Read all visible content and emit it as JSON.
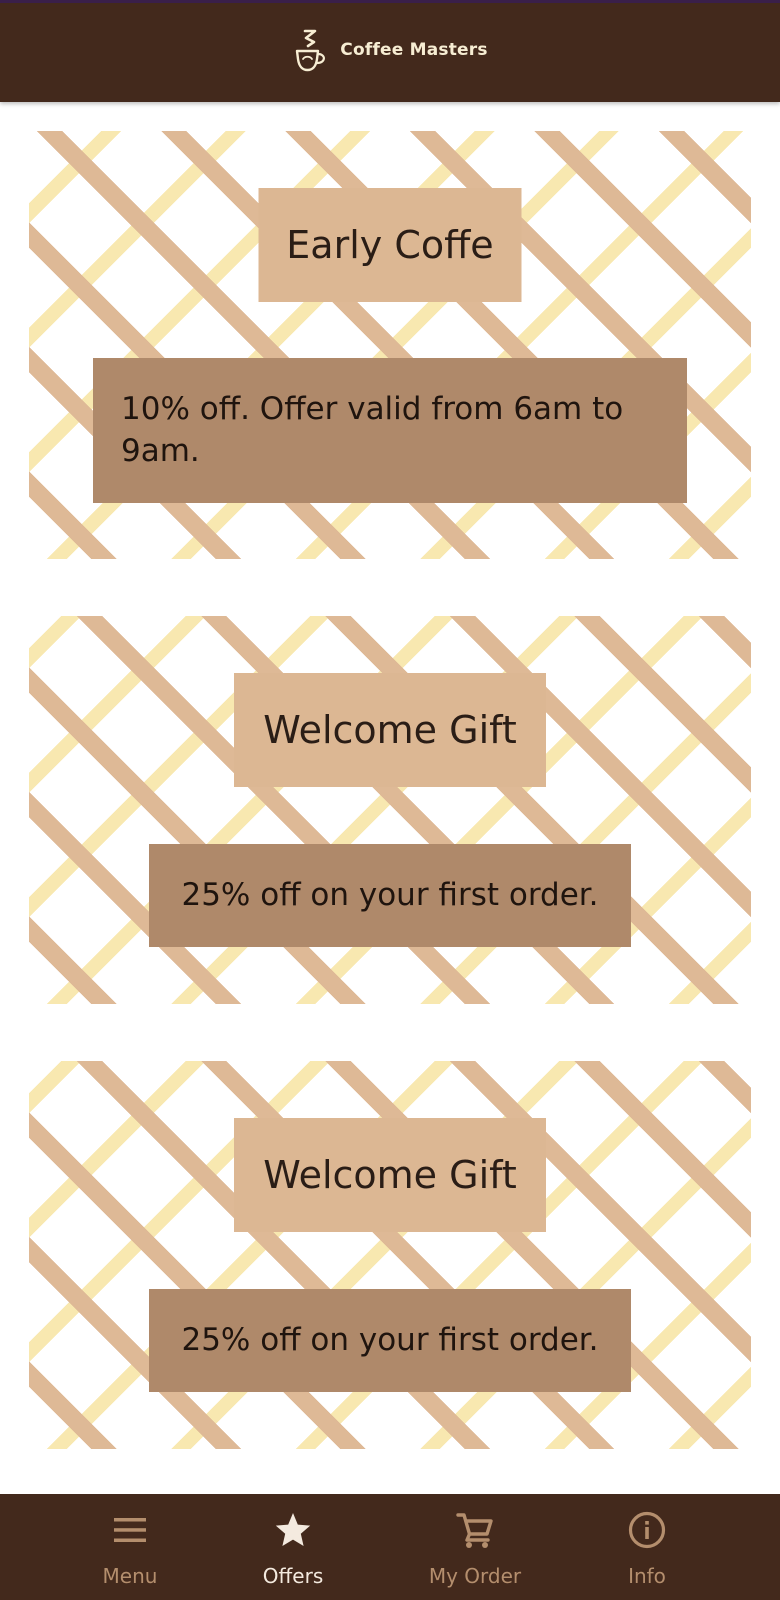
{
  "header": {
    "title": "Coffee Masters",
    "logo_icon": "coffee-cup-logo-icon",
    "background_color": "#43291c",
    "title_color": "#f7edd3"
  },
  "offers": [
    {
      "title": "Early Coffe",
      "description": "10% off. Offer valid from 6am to 9am."
    },
    {
      "title": "Welcome Gift",
      "description": "25% off on your first order."
    },
    {
      "title": "Welcome Gift",
      "description": "25% off on your first order."
    }
  ],
  "colors": {
    "title_box": "#dcb793",
    "description_box": "#af896a",
    "pattern_tan": "#deb996",
    "pattern_yellow": "#f8e8b0"
  },
  "bottom_nav": {
    "items": [
      {
        "label": "Menu",
        "icon": "menu-icon",
        "active": false
      },
      {
        "label": "Offers",
        "icon": "star-icon",
        "active": true
      },
      {
        "label": "My Order",
        "icon": "cart-icon",
        "active": false
      },
      {
        "label": "Info",
        "icon": "info-icon",
        "active": false
      }
    ],
    "active_color": "#f4eadf",
    "inactive_color": "#b48e6d"
  }
}
